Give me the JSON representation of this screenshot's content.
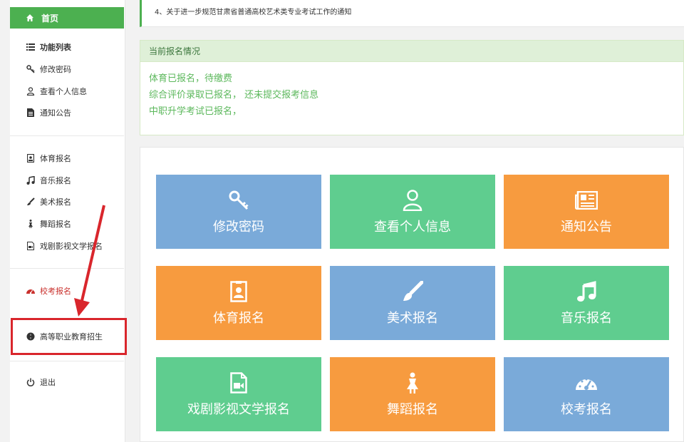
{
  "sidebar": {
    "home": "首页",
    "group1": [
      {
        "label": "功能列表",
        "icon": "list-icon"
      },
      {
        "label": "修改密码",
        "icon": "key-icon"
      },
      {
        "label": "查看个人信息",
        "icon": "user-icon"
      },
      {
        "label": "通知公告",
        "icon": "document-icon"
      }
    ],
    "group2": [
      {
        "label": "体育报名",
        "icon": "id-card-icon"
      },
      {
        "label": "音乐报名",
        "icon": "music-icon"
      },
      {
        "label": "美术报名",
        "icon": "brush-icon"
      },
      {
        "label": "舞蹈报名",
        "icon": "dancer-icon"
      },
      {
        "label": "戏剧影视文学报名",
        "icon": "video-file-icon"
      }
    ],
    "school_exam": "校考报名",
    "vocational": "高等职业教育招生",
    "logout": "退出"
  },
  "notice": {
    "text": "4、关于进一步规范甘肃省普通高校艺术类专业考试工作的通知"
  },
  "status": {
    "title": "当前报名情况",
    "lines": [
      "体育已报名，待缴费",
      "综合评价录取已报名， 还未提交报考信息",
      "中职升学考试已报名，"
    ]
  },
  "tiles": [
    {
      "label": "修改密码",
      "icon": "key-icon",
      "color": "#7aaad9"
    },
    {
      "label": "查看个人信息",
      "icon": "user-icon",
      "color": "#5fcd8f"
    },
    {
      "label": "通知公告",
      "icon": "newspaper-icon",
      "color": "#f79b3f"
    },
    {
      "label": "体育报名",
      "icon": "id-card-icon",
      "color": "#f79b3f"
    },
    {
      "label": "美术报名",
      "icon": "brush-icon",
      "color": "#7aaad9"
    },
    {
      "label": "音乐报名",
      "icon": "music-icon",
      "color": "#5fcd8f"
    },
    {
      "label": "戏剧影视文学报名",
      "icon": "video-file-icon",
      "color": "#5fcd8f"
    },
    {
      "label": "舞蹈报名",
      "icon": "dancer-icon",
      "color": "#f79b3f"
    },
    {
      "label": "校考报名",
      "icon": "dashboard-icon",
      "color": "#7aaad9"
    }
  ],
  "colors": {
    "accent_green": "#4cb050",
    "highlight_red": "#d9262c"
  }
}
